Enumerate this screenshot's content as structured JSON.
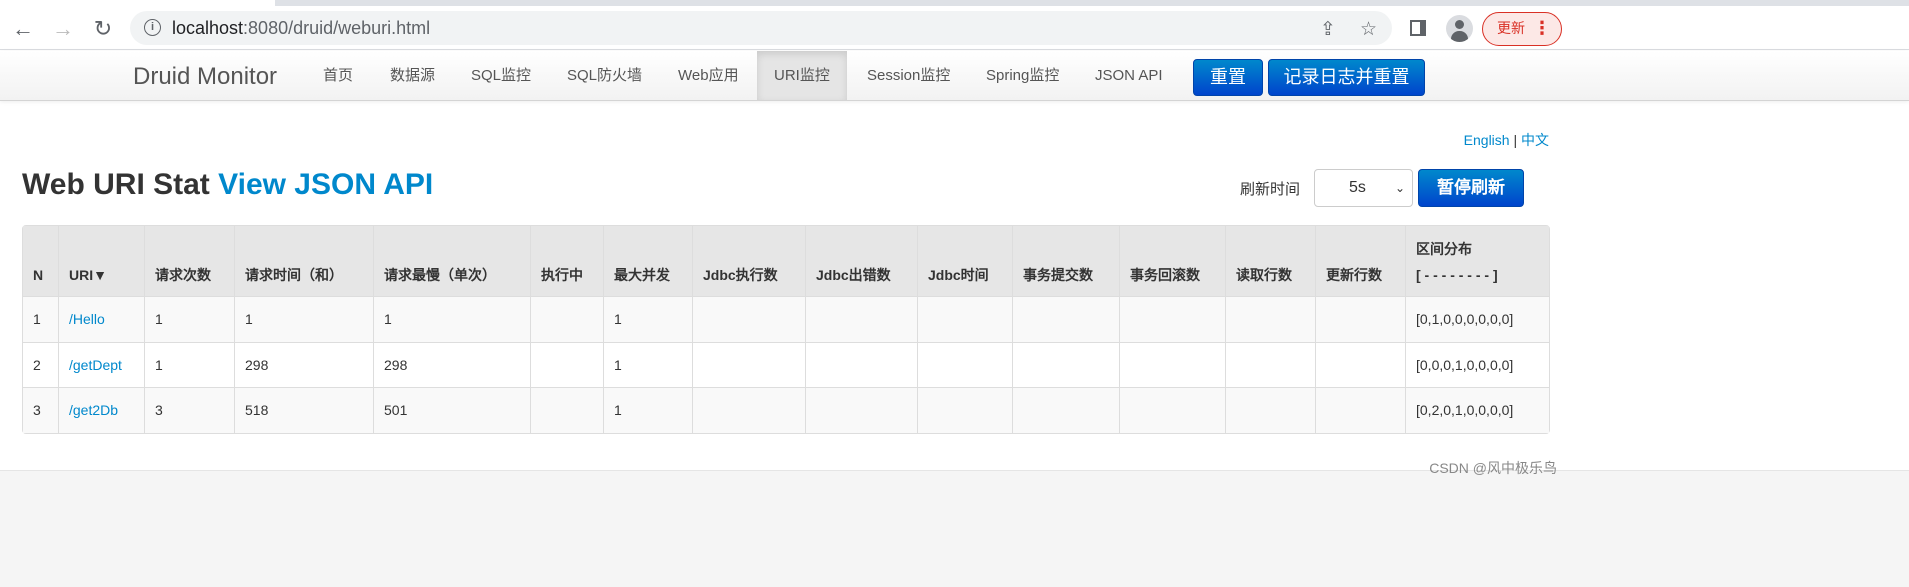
{
  "browser": {
    "url_host": "localhost",
    "url_rest": ":8080/druid/weburi.html",
    "update_label": "更新"
  },
  "nav": {
    "brand": "Druid Monitor",
    "items": [
      "首页",
      "数据源",
      "SQL监控",
      "SQL防火墙",
      "Web应用",
      "URI监控",
      "Session监控",
      "Spring监控",
      "JSON API"
    ],
    "reset": "重置",
    "log_reset": "记录日志并重置"
  },
  "lang": {
    "english": "English",
    "sep": "|",
    "chinese": "中文"
  },
  "page": {
    "title": "Web URI Stat",
    "json_link": "View JSON API",
    "refresh_label": "刷新时间",
    "refresh_value": "5s",
    "pause": "暂停刷新"
  },
  "table": {
    "headers": [
      "N",
      "URI▼",
      "请求次数",
      "请求时间（和）",
      "请求最慢（单次）",
      "执行中",
      "最大并发",
      "Jdbc执行数",
      "Jdbc出错数",
      "Jdbc时间",
      "事务提交数",
      "事务回滚数",
      "读取行数",
      "更新行数",
      "区间分布"
    ],
    "header_sub": "[ - - - - - - - - ]",
    "rows": [
      [
        "1",
        "/Hello",
        "1",
        "1",
        "1",
        "",
        "1",
        "",
        "",
        "",
        "",
        "",
        "",
        "",
        "[0,1,0,0,0,0,0,0]"
      ],
      [
        "2",
        "/getDept",
        "1",
        "298",
        "298",
        "",
        "1",
        "",
        "",
        "",
        "",
        "",
        "",
        "",
        "[0,0,0,1,0,0,0,0]"
      ],
      [
        "3",
        "/get2Db",
        "3",
        "518",
        "501",
        "",
        "1",
        "",
        "",
        "",
        "",
        "",
        "",
        "",
        "[0,2,0,1,0,0,0,0]"
      ]
    ]
  },
  "watermark": "CSDN @风中极乐鸟"
}
